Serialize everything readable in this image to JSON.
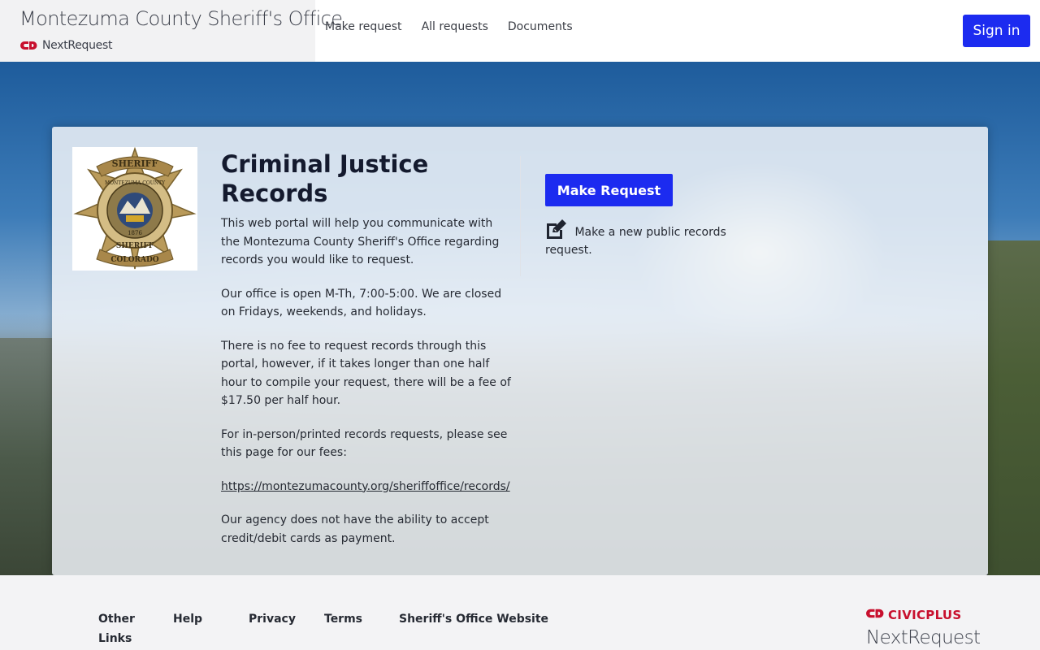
{
  "header": {
    "org_title": "Montezuma County Sheriff's Office",
    "product": "NextRequest",
    "nav": [
      "Make request",
      "All requests",
      "Documents"
    ],
    "sign_in": "Sign in"
  },
  "card": {
    "badge_text": {
      "top": "SHERIFF",
      "ring": "MONTEZUMA COUNTY",
      "year": "1876",
      "bottom": "SHERIFF",
      "banner": "COLORADO"
    },
    "title": "Criminal Justice Records",
    "paragraphs": [
      "This web portal will help you communicate with the Montezuma County Sheriff's Office regarding records you would like to request.",
      "Our office is open M-Th, 7:00-5:00. We are closed on Fridays, weekends, and holidays.",
      "There is no fee to request records through this portal, however, if it takes longer than one half hour to compile your request, there will be a fee of $17.50 per half hour.",
      "For in-person/printed records requests, please see this page for our fees:"
    ],
    "link": "https://montezumacounty.org/sheriffoffice/records/",
    "last_paragraph": "Our agency does not have the ability to accept credit/debit cards as payment.",
    "make_request_button": "Make Request",
    "make_request_note": "Make a new public records request."
  },
  "footer": {
    "links": [
      "Other Links",
      "Help",
      "Privacy",
      "Terms",
      "Sheriff's Office Website"
    ],
    "civicplus": "CIVICPLUS",
    "nextrequest": "NextRequest"
  },
  "colors": {
    "primary": "#1c2bf0",
    "brand_red": "#c8102e",
    "text_dark": "#141a2e"
  },
  "icons": [
    "civicplus-logo-icon",
    "edit-icon",
    "sheriff-badge-logo"
  ]
}
